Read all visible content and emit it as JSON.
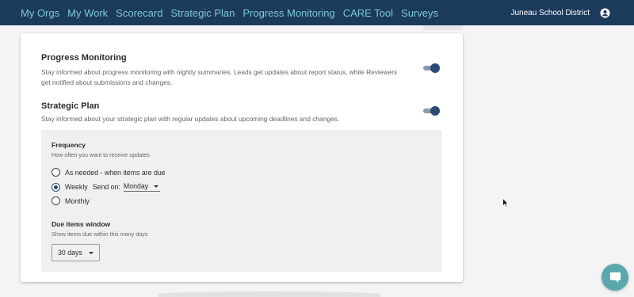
{
  "nav": {
    "links": [
      "My Orgs",
      "My Work",
      "Scorecard",
      "Strategic Plan",
      "Progress Monitoring",
      "CARE Tool",
      "Surveys"
    ],
    "district": "Juneau School District",
    "icon": "user-circle-icon"
  },
  "settings": {
    "progress_monitoring": {
      "title": "Progress Monitoring",
      "desc_line1": "Stay informed about progress monitoring with nightly summaries. Leads get updates about report status, while Reviewers",
      "desc_line2": "get notified about submissions and changes.",
      "enabled": true
    },
    "strategic_plan": {
      "title": "Strategic Plan",
      "desc": "Stay informed about your strategic plan with regular updates about upcoming deadlines and changes.",
      "enabled": true
    },
    "frequency": {
      "title": "Frequency",
      "subtitle": "How often you want to receive updates",
      "options": [
        "As needed - when items are due",
        "Weekly",
        "Monthly"
      ],
      "selected": "Weekly",
      "send_on_label": "Send on:",
      "send_on_value": "Monday"
    },
    "due_window": {
      "title": "Due items window",
      "subtitle": "Show items due within this many days",
      "value": "30 days"
    }
  },
  "colors": {
    "navbar": "#1b3a5c",
    "nav_link": "#7ec8d8",
    "accent": "#2b4b75",
    "chat": "#5aa8ad"
  },
  "chat": {
    "icon": "chat-bubble-icon"
  }
}
